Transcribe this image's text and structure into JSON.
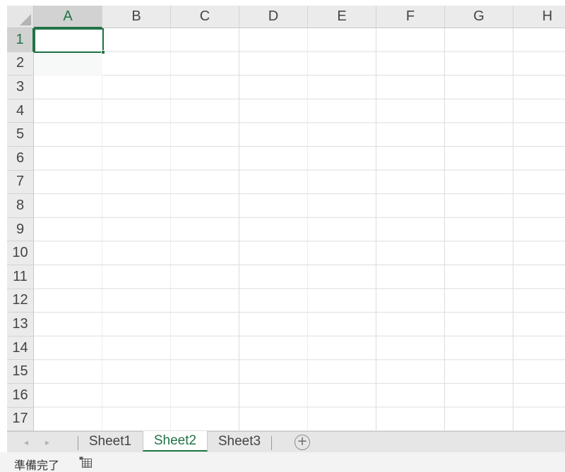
{
  "columns": [
    "A",
    "B",
    "C",
    "D",
    "E",
    "F",
    "G",
    "H"
  ],
  "rows": [
    "1",
    "2",
    "3",
    "4",
    "5",
    "6",
    "7",
    "8",
    "9",
    "10",
    "11",
    "12",
    "13",
    "14",
    "15",
    "16",
    "17"
  ],
  "selected_cell": {
    "column": "A",
    "row": "1"
  },
  "sheets": [
    {
      "label": "Sheet1",
      "active": false
    },
    {
      "label": "Sheet2",
      "active": true
    },
    {
      "label": "Sheet3",
      "active": false
    }
  ],
  "tabbar": {
    "prev_icon": "◂",
    "next_icon": "▸",
    "add_icon": "+"
  },
  "status": {
    "ready_text": "準備完了",
    "icon": "macro-record-icon"
  },
  "colors": {
    "accent": "#217346",
    "header_bg": "#ebebeb",
    "gridline": "#dcdcdc"
  }
}
